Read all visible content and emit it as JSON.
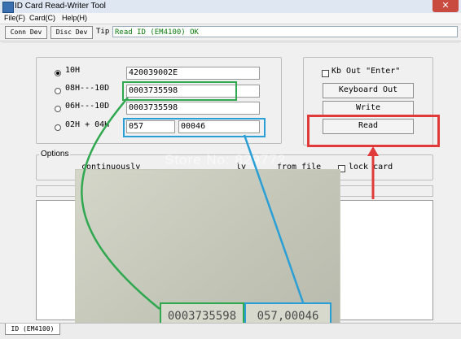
{
  "window": {
    "title": "ID Card Read-Writer Tool",
    "close_glyph": "✕"
  },
  "menu": [
    {
      "label": "File(F)"
    },
    {
      "label": "Card(C)"
    },
    {
      "label": "Help(H)"
    }
  ],
  "toolbar": {
    "conn_label": "Conn Dev",
    "disc_label": "Disc Dev",
    "tip_label": "Tip",
    "status_text": "Read ID (EM4100) OK"
  },
  "formats": [
    {
      "label": "10H",
      "value": "420039002E",
      "selected": true
    },
    {
      "label": "08H---10D",
      "value": "0003735598",
      "selected": false
    },
    {
      "label": "06H---10D",
      "value": "0003735598",
      "selected": false
    },
    {
      "label": "02H + 04H",
      "value_a": "057",
      "value_b": "00046",
      "selected": false
    }
  ],
  "actions": {
    "kb_out_enter_label": "Kb Out \"Enter\"",
    "keyboard_out_label": "Keyboard Out",
    "write_label": "Write",
    "read_label": "Read"
  },
  "options": {
    "title": "Options",
    "continuous_text": "continuously",
    "manual_text": "ly",
    "from_file_text": "from file",
    "lock_card_label": "lock card"
  },
  "card": {
    "number_decimal": "0003735598",
    "number_split": "057,00046"
  },
  "watermark": "Store No: 829772",
  "status_tab": "ID (EM4100)",
  "colors": {
    "highlight_green": "#2fa84f",
    "highlight_blue": "#2a9fd6",
    "highlight_red": "#e03a3a",
    "status_ok": "#0a7a0a"
  }
}
